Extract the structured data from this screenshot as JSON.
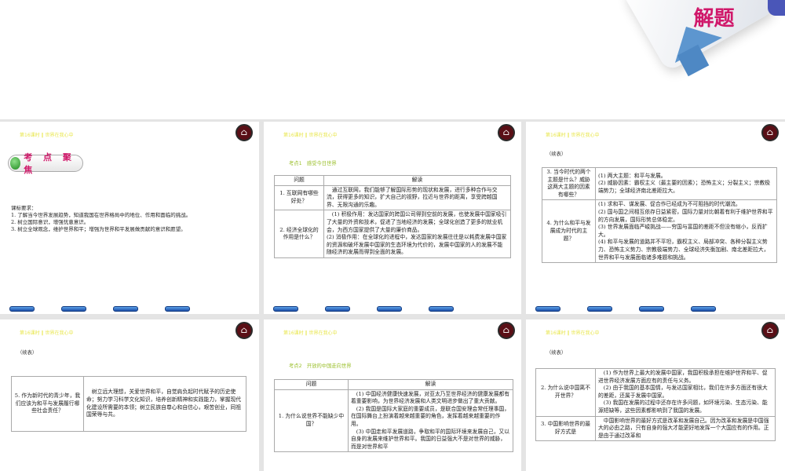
{
  "header": "第16课时 ‖ 世界在我心中",
  "home_icon": "home-icon",
  "deco_text": "解题",
  "continued": "（续表）",
  "col_q": "问题",
  "col_a": "解读",
  "s1": {
    "tag": "考 点 聚 焦",
    "lines": [
      "课标要求：",
      "1. 了解当今世界发展趋势，知道我国在世界格局中的地位、作用和面临的挑战。",
      "2. 树立国际意识，增强忧患意识。",
      "3. 树立全球观念，维护世界和平；增强为世界和平发展做贡献的意识和愿望。"
    ]
  },
  "s2": {
    "kp": "考点1　感受今日世界",
    "rows": [
      {
        "q": "1. 互联网有哪些好处？",
        "a": "　通过互联网，我们能够了解国际形势的现状和发展，进行多种合作与交流，获得更多的知识，扩大自己的视野，拉近与世界的距离，享受跨越国界、无限沟通的乐趣。"
      },
      {
        "q": "2. 经济全球化的作用是什么？",
        "a": "　(1) 积极作用：发达国家的跨国公司得到空前的发展，也使发展中国家吸引了大量的外资和技术，促进了当地经济的发展；全球化创造了更多的就业机会，为西方国家提供了大量的廉价商品。\n(2) 消极作用：在全球化的进程中，发达国家的发展往往是以耗费发展中国家的资源和破坏发展中国家的生态环境为代价的，发展中国家的人的发展不能随经济的发展而得到全面的发展。"
      }
    ]
  },
  "s3": {
    "rows": [
      {
        "q": "3. 当今时代的两个主题是什么？威胁这两大主题的因素有哪些？",
        "a": "(1) 两大主题：和平与发展。\n(2) 威胁因素：霸权主义（最主要的因素）；恐怖主义；分裂主义；宗教极端势力；全球经济南北差距拉大。"
      },
      {
        "q": "4. 为什么和平与发展成为时代的主题？",
        "a": "(1) 求和平、谋发展、促合作已经成为不可阻挡的时代潮流。\n(2) 国与国之间相互依存日益紧密，国际力量对比朝着有利于维护世界和平的方向发展，国际形势总体稳定。\n(3) 世界发展面临严峻挑战——穷国与富国的差距不但没有缩小，反而扩大。\n(4) 和平与发展的道路并不平坦，霸权主义、局部冲突、各种分裂主义势力、恐怖主义势力、宗教极端势力、全球经济失衡加剧、南北差距拉大，世界和平与发展面临诸多难题和挑战。"
      }
    ]
  },
  "s4": {
    "rows": [
      {
        "q": "5. 作为新时代的青少年，我们应该为和平与发展履行哪些社会责任？",
        "a": "　树立远大理想，关爱世界和平，自觉肩负起时代赋予的历史使命；努力学习科学文化知识，培养创新精神和实践能力，掌握现代化建设所需要的本领；树立民族自尊心和自信心，艰苦创业，同祖国荣辱与共。"
      }
    ]
  },
  "s5": {
    "kp": "考点2　开放的中国走向世界",
    "rows": [
      {
        "q": "1. 为什么说世界不能缺少中国？",
        "a": "　(1) 中国经济健康快速发展，对亚太乃至世界经济的健康发展都有着重要影响，为世界经济发展和人类文明进步做出了重大贡献。\n　(2) 我国是国际大家庭的重要成员，是联合国安理会常任理事国，在国际舞台上扮演着越来越重要的角色，发挥着越来越重要的作用。\n　(3) 中国走和平发展道路，争取和平的国际环境来发展自己，又以自身的发展来维护世界和平。我国的日益强大不是对世界的威胁，而是对世界和平"
      }
    ]
  },
  "s6": {
    "rows": [
      {
        "q": "2. 为什么说中国离不开世界？",
        "a": "　(1) 作为世界上最大的发展中国家，我国积极承担在维护世界和平、促进世界经济发展方面应有的责任与义务。\n　(2) 由于我国的基本国情，与发达国家相比，我们在许多方面还有很大的差距，还属于发展中国家。\n　(3) 我国在发展的过程中还存在许多问题，如环境污染、生态污染、能源短缺等，这些因素都影响到了我国的发展。"
      },
      {
        "q": "3. 中国影响世界的最好方式是",
        "a": "　中国影响世界的最好方式是改革和发展自己。因为改革和发展是中国强大的必由之路，只有自身的强大才能更好地发挥一个大国应有的作用。正是由于通过改革和"
      }
    ]
  }
}
